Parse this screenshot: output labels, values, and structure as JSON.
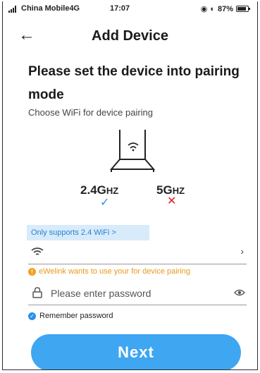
{
  "status_bar": {
    "carrier": "China Mobile4G",
    "time": "17:07",
    "battery": "87%"
  },
  "nav": {
    "back_icon": "←",
    "title": "Add Device"
  },
  "instructions": {
    "headline": "Please set the device into pairing mode",
    "subtitle": "Choose WiFi for device pairing"
  },
  "bands": {
    "band_24_main": "2.4G",
    "band_24_unit": "HZ",
    "band_5_main": "5G",
    "band_5_unit": "HZ",
    "check": "✓",
    "cross": "✕"
  },
  "wifi": {
    "notice": "Only supports 2.4 WiFi >",
    "chevron": "›"
  },
  "password": {
    "warning": "eWelink wants to use your for device pairing",
    "warning_icon": "!",
    "placeholder": "Please enter password",
    "remember_label": "Remember password",
    "remember_checked": true,
    "check_glyph": "✓"
  },
  "actions": {
    "next_label": "Next"
  },
  "colors": {
    "accent": "#3fa6f2",
    "notice_bg": "#d7ebfa",
    "warning": "#e79a1a",
    "error": "#e02020"
  }
}
